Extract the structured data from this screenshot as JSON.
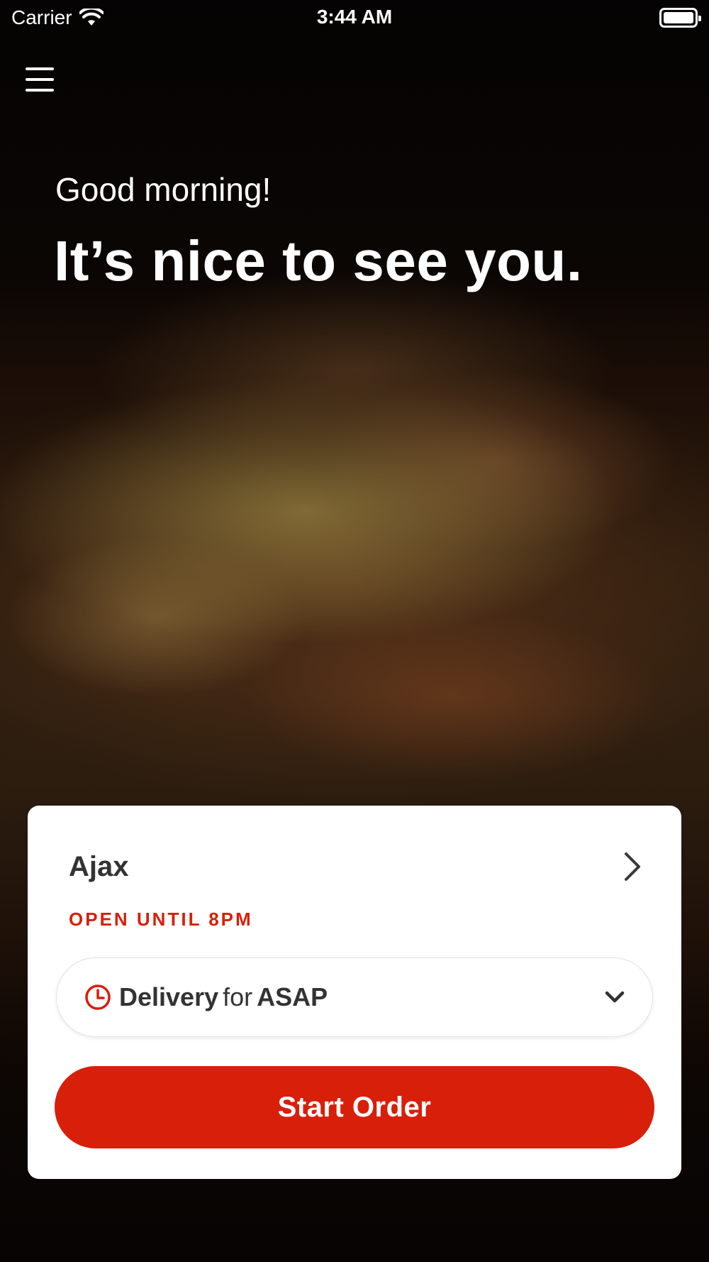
{
  "status_bar": {
    "carrier": "Carrier",
    "time": "3:44 AM"
  },
  "greeting": {
    "subtitle": "Good morning!",
    "title": "It’s nice to see you."
  },
  "card": {
    "store_name": "Ajax",
    "open_status": "OPEN UNTIL 8PM",
    "delivery": {
      "mode": "Delivery",
      "connector": "for",
      "time": "ASAP"
    },
    "start_button_label": "Start Order"
  },
  "colors": {
    "accent": "#d81f0a",
    "card_background": "#ffffff",
    "text_dark": "#333333"
  },
  "icons": {
    "menu": "hamburger-menu-icon",
    "wifi": "wifi-icon",
    "battery": "battery-icon",
    "store_chevron": "chevron-right-icon",
    "clock": "clock-icon",
    "dropdown": "chevron-down-icon"
  }
}
